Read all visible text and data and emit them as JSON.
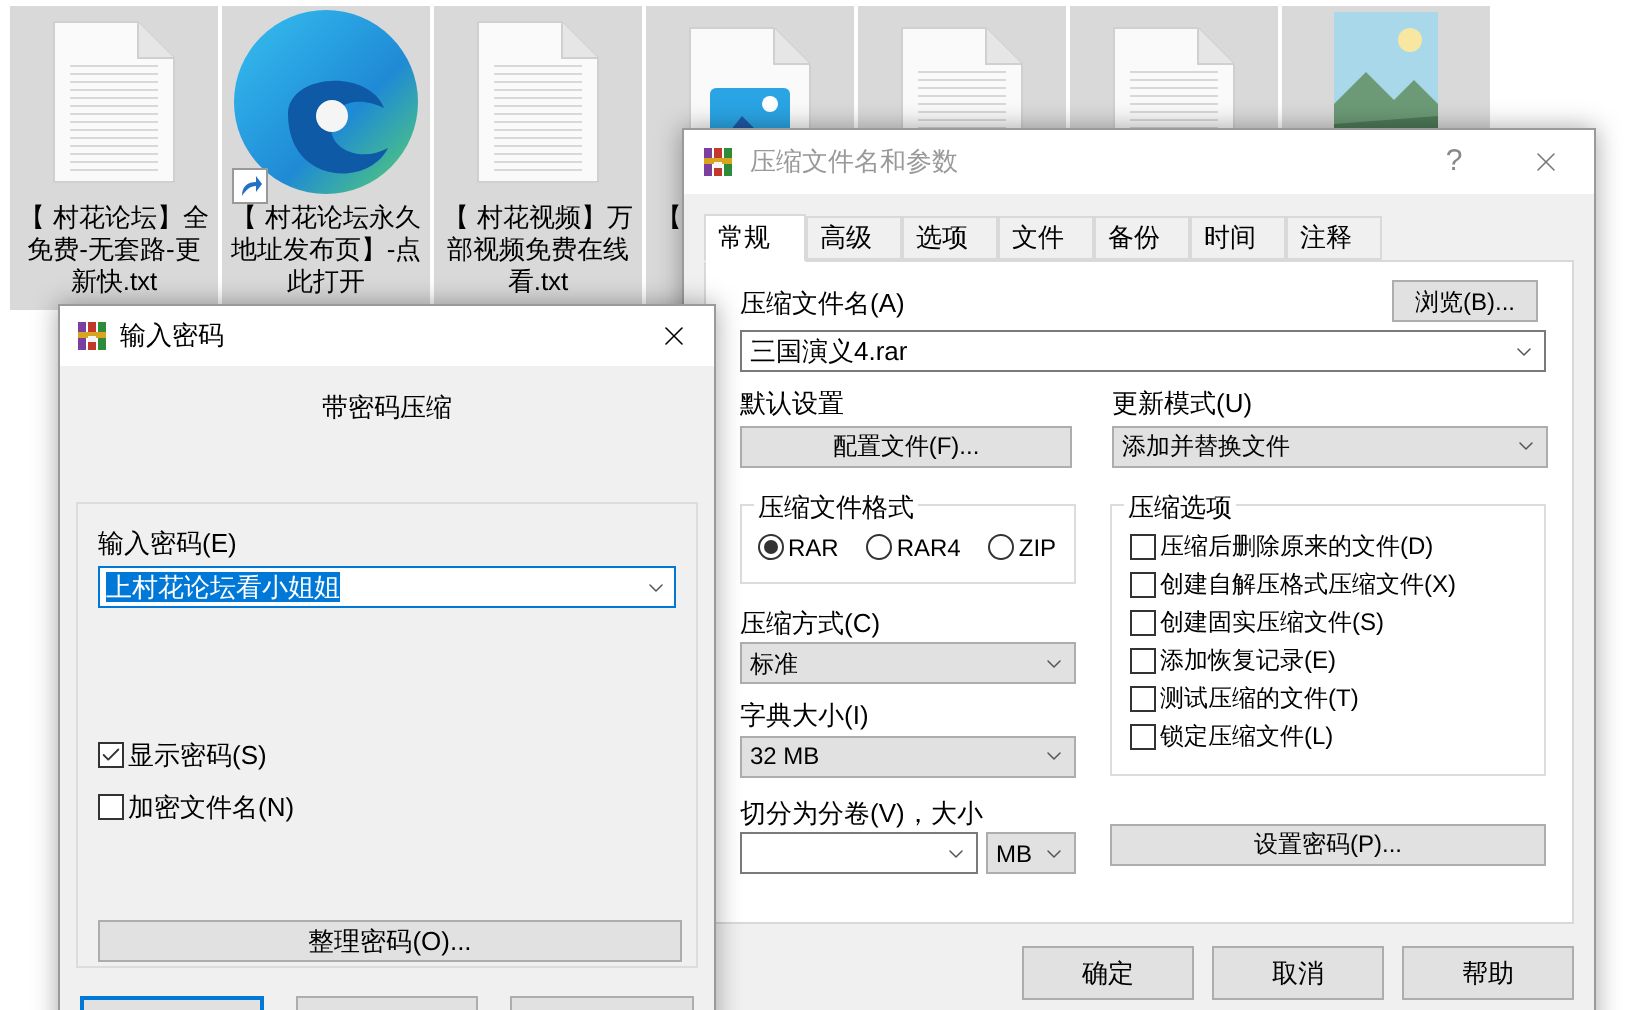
{
  "desktop_icons": [
    {
      "kind": "text_file",
      "label_lines": [
        "【 村花论坛】全",
        "免费-无套路-更",
        "新快.txt"
      ]
    },
    {
      "kind": "browser_shortcut",
      "label_lines": [
        "【 村花论坛永久",
        "地址发布页】-点",
        "此打开"
      ]
    },
    {
      "kind": "text_file",
      "label_lines": [
        "【 村花视频】万",
        "部视频免费在线",
        "看.txt"
      ]
    },
    {
      "kind": "image_file",
      "label_lines": [
        "【"
      ]
    },
    {
      "kind": "text_file"
    },
    {
      "kind": "text_file"
    },
    {
      "kind": "picture"
    }
  ],
  "archive_dialog": {
    "title": "压缩文件名和参数",
    "help": "?",
    "tabs": [
      {
        "label": "常规",
        "selected": true
      },
      {
        "label": "高级",
        "selected": false
      },
      {
        "label": "选项",
        "selected": false
      },
      {
        "label": "文件",
        "selected": false
      },
      {
        "label": "备份",
        "selected": false
      },
      {
        "label": "时间",
        "selected": false
      },
      {
        "label": "注释",
        "selected": false
      }
    ],
    "archive_name": {
      "label": "压缩文件名(A)",
      "value": "三国演义4.rar"
    },
    "browse_button": "浏览(B)...",
    "default_settings": {
      "label": "默认设置",
      "button": "配置文件(F)..."
    },
    "update_mode": {
      "label": "更新模式(U)",
      "value": "添加并替换文件"
    },
    "format": {
      "label": "压缩文件格式",
      "options": [
        {
          "label": "RAR",
          "selected": true
        },
        {
          "label": "RAR4",
          "selected": false
        },
        {
          "label": "ZIP",
          "selected": false
        }
      ]
    },
    "options_group": {
      "label": "压缩选项",
      "items": [
        {
          "label": "压缩后删除原来的文件(D)",
          "checked": false
        },
        {
          "label": "创建自解压格式压缩文件(X)",
          "checked": false
        },
        {
          "label": "创建固实压缩文件(S)",
          "checked": false
        },
        {
          "label": "添加恢复记录(E)",
          "checked": false
        },
        {
          "label": "测试压缩的文件(T)",
          "checked": false
        },
        {
          "label": "锁定压缩文件(L)",
          "checked": false
        }
      ]
    },
    "method": {
      "label": "压缩方式(C)",
      "value": "标准"
    },
    "dictionary": {
      "label": "字典大小(I)",
      "value": "32 MB"
    },
    "split": {
      "label": "切分为分卷(V)，大小",
      "unit": "MB"
    },
    "password_button": "设置密码(P)...",
    "buttons": [
      "确定",
      "取消",
      "帮助"
    ]
  },
  "password_dialog": {
    "title": "输入密码",
    "heading": "带密码压缩",
    "password": {
      "label": "输入密码(E)",
      "value": "上村花论坛看小姐姐",
      "highlighted": true
    },
    "checkboxes": [
      {
        "label": "显示密码(S)",
        "checked": true
      },
      {
        "label": "加密文件名(N)",
        "checked": false
      }
    ],
    "organize_button": "整理密码(O)...",
    "bottom_buttons": [
      {
        "default": true
      },
      {
        "default": false
      },
      {
        "default": false
      }
    ]
  }
}
